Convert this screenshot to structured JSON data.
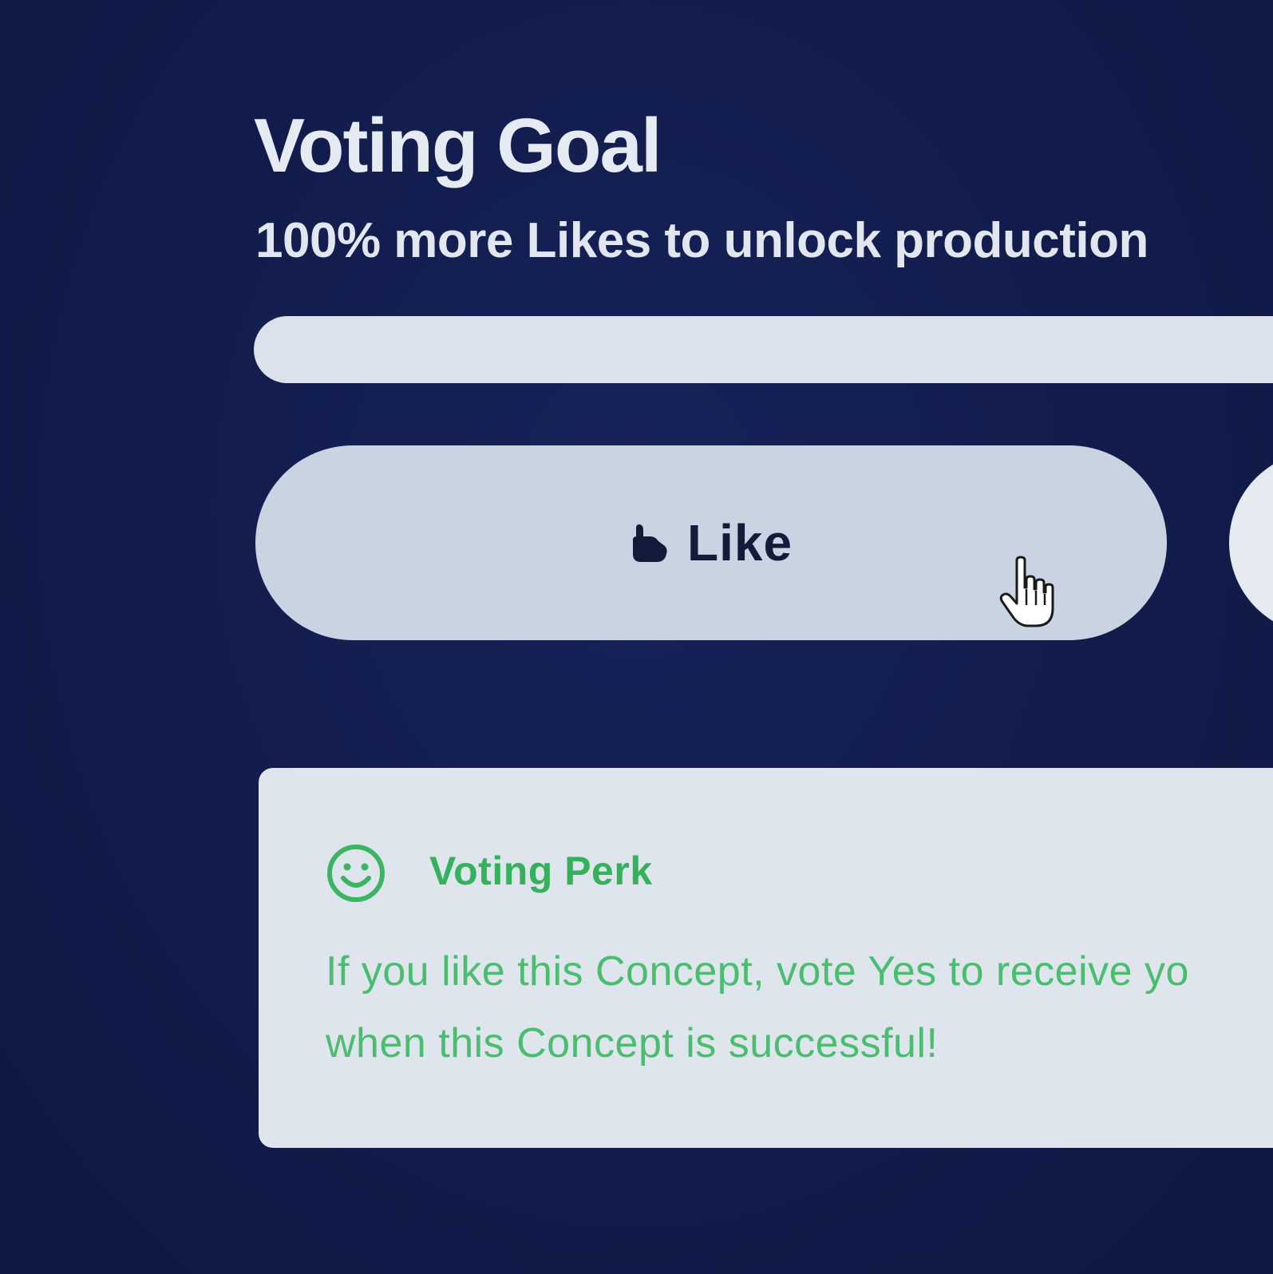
{
  "voting_goal": {
    "title": "Voting Goal",
    "subtitle": "100% more Likes to unlock production",
    "progress_percent": 0
  },
  "actions": {
    "like_label": "Like",
    "like_icon": "thumbs-up-icon",
    "cursor_icon": "pointer-hand-icon"
  },
  "perk": {
    "icon": "smiley-face-icon",
    "title": "Voting Perk",
    "text_line1": "If you like this Concept, vote Yes to receive yo",
    "text_line2": "when this Concept is successful!"
  },
  "colors": {
    "background": "#121d4c",
    "heading_text": "#e6ebf3",
    "button_bg": "#c9d3e1",
    "card_bg": "#dfe5ec",
    "perk_green": "#34b15b"
  }
}
